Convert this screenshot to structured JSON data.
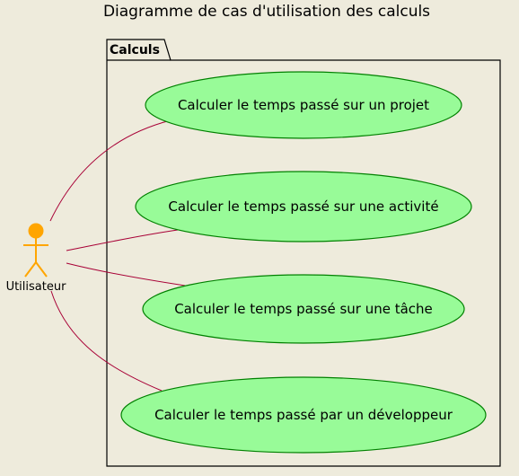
{
  "diagram": {
    "title": "Diagramme de cas d'utilisation des calculs",
    "package": {
      "name": "Calculs"
    },
    "actor": {
      "name": "Utilisateur"
    },
    "use_cases": [
      {
        "label": "Calculer le temps passé sur un projet"
      },
      {
        "label": "Calculer le temps passé sur une activité"
      },
      {
        "label": "Calculer le temps passé sur une tâche"
      },
      {
        "label": "Calculer le temps passé par un développeur"
      }
    ],
    "colors": {
      "background": "#EEEBDC",
      "usecase_fill": "#98FB98",
      "usecase_border": "#008000",
      "actor": "#FFA500",
      "association_line": "#A80036",
      "package_border": "#000000"
    }
  }
}
